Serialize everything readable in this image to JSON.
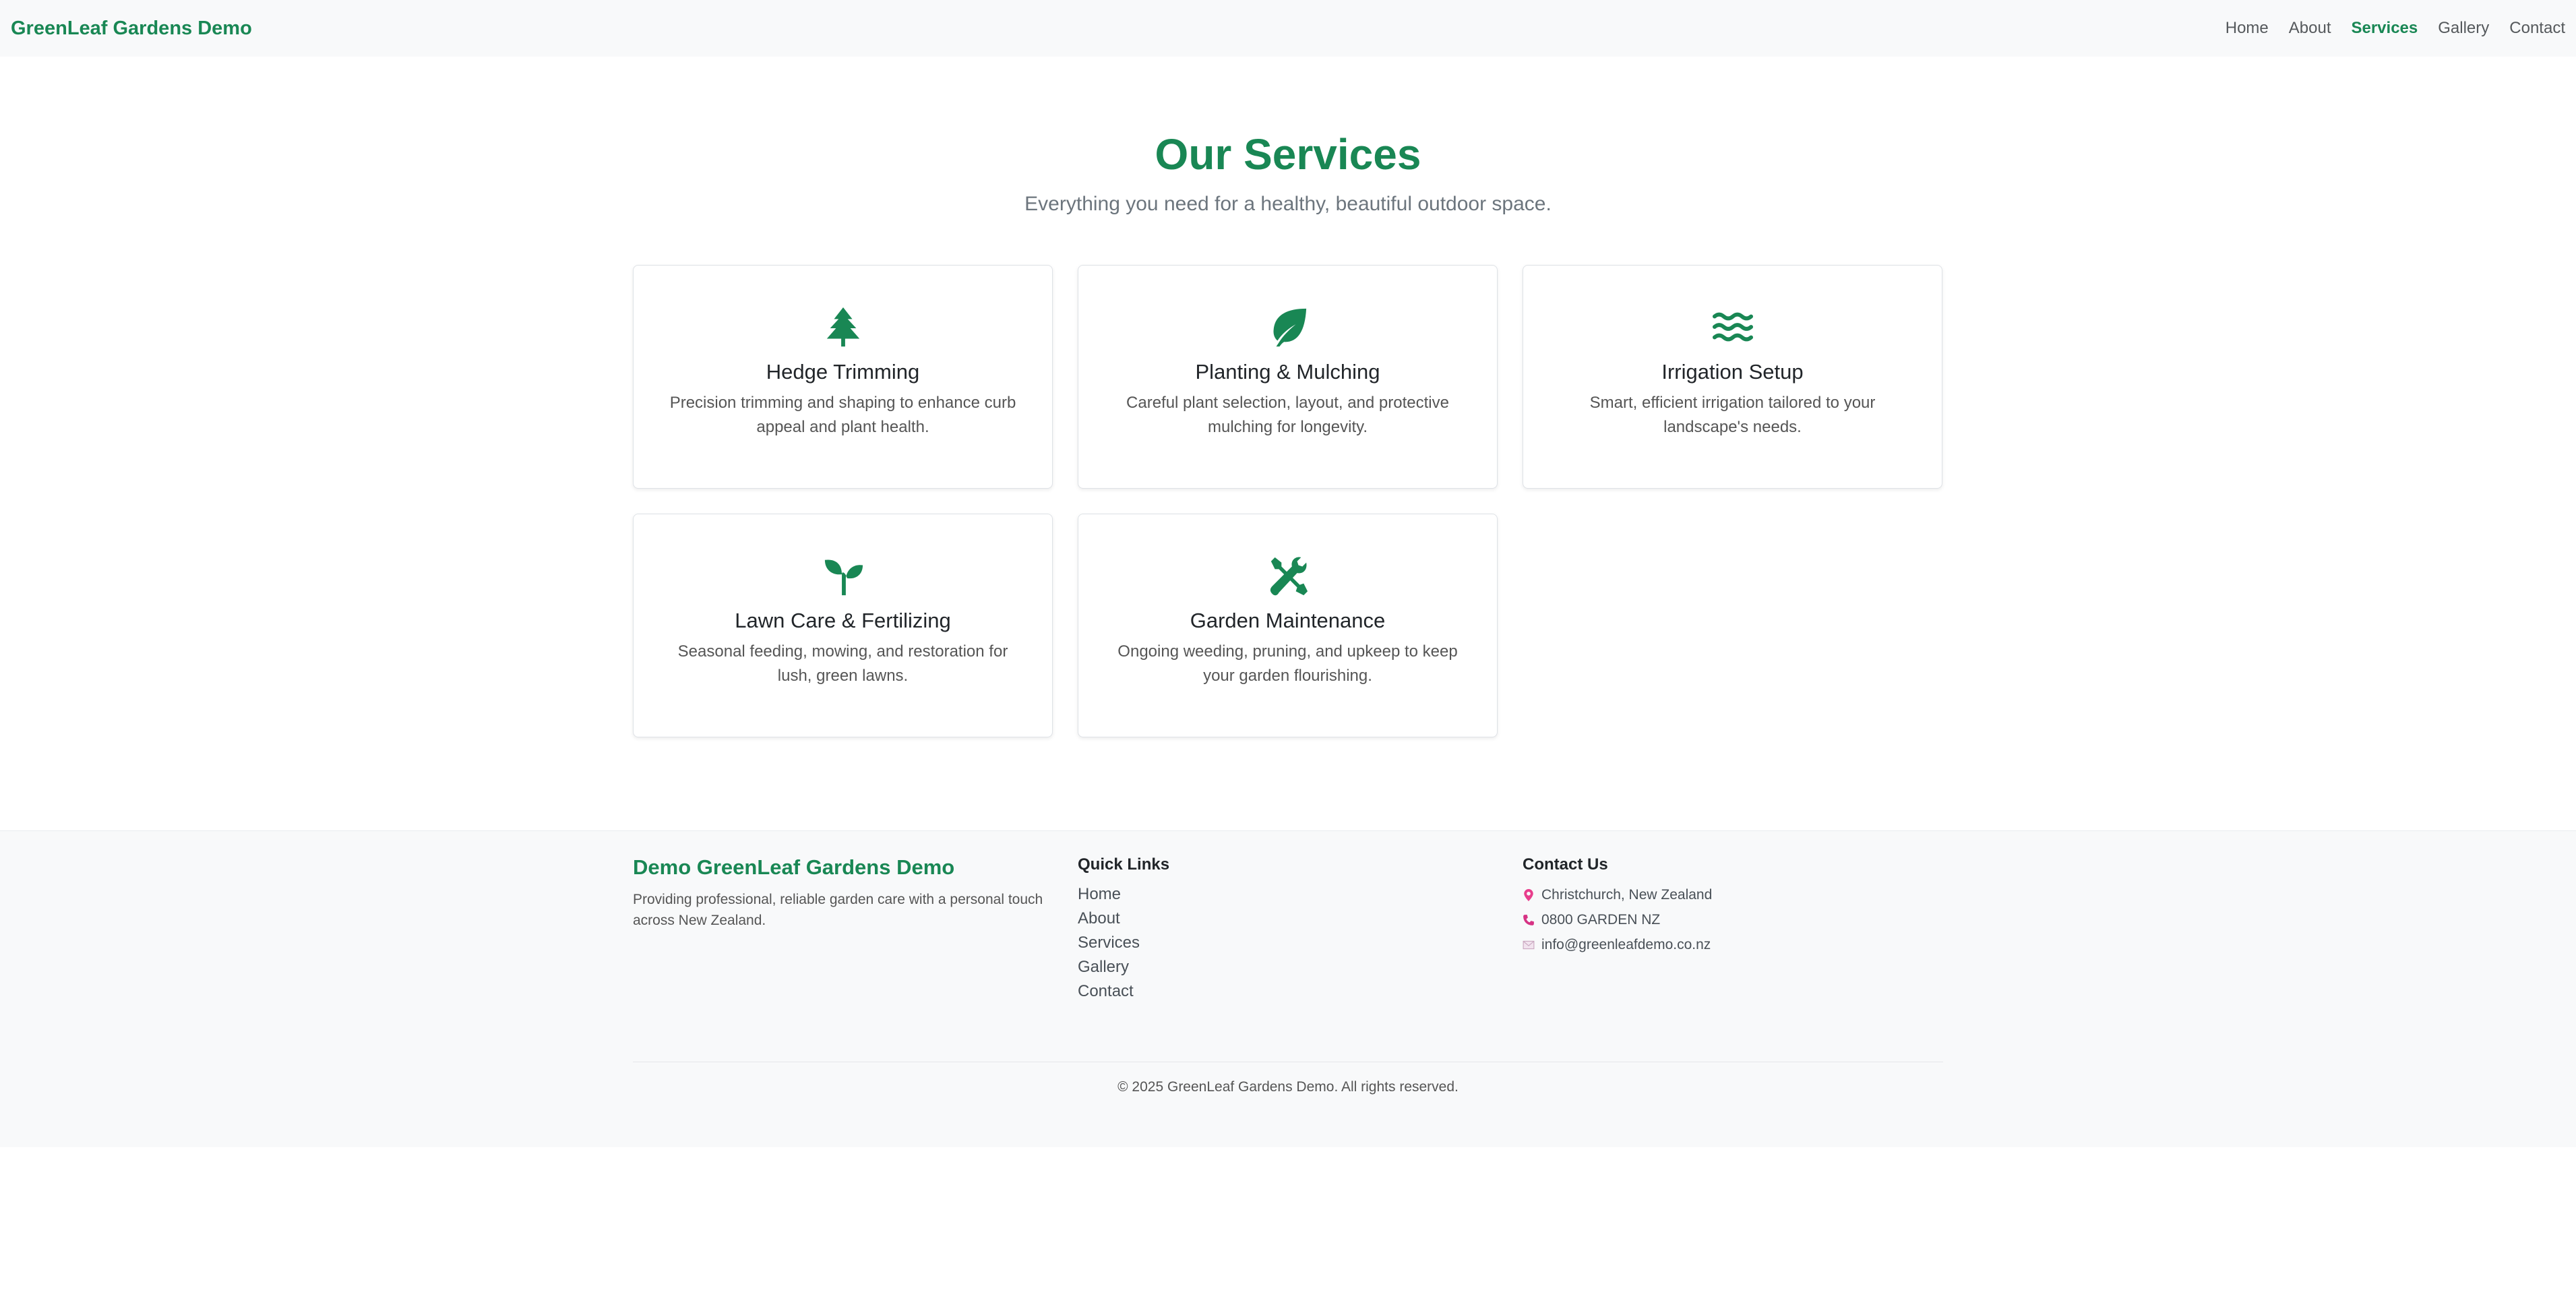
{
  "nav": {
    "brand": "GreenLeaf Gardens Demo",
    "links": [
      "Home",
      "About",
      "Services",
      "Gallery",
      "Contact"
    ],
    "active": "Services"
  },
  "hero": {
    "title": "Our Services",
    "subtitle": "Everything you need for a healthy, beautiful outdoor space."
  },
  "services": [
    {
      "icon": "tree-icon",
      "title": "Hedge Trimming",
      "desc": "Precision trimming and shaping to enhance curb appeal and plant health."
    },
    {
      "icon": "leaf-icon",
      "title": "Planting & Mulching",
      "desc": "Careful plant selection, layout, and protective mulching for longevity."
    },
    {
      "icon": "water-waves-icon",
      "title": "Irrigation Setup",
      "desc": "Smart, efficient irrigation tailored to your landscape's needs."
    },
    {
      "icon": "seedling-icon",
      "title": "Lawn Care & Fertilizing",
      "desc": "Seasonal feeding, mowing, and restoration for lush, green lawns."
    },
    {
      "icon": "tools-icon",
      "title": "Garden Maintenance",
      "desc": "Ongoing weeding, pruning, and upkeep to keep your garden flourishing."
    }
  ],
  "footer": {
    "brand": "Demo GreenLeaf Gardens Demo",
    "description": "Providing professional, reliable garden care with a personal touch across New Zealand.",
    "quick_links_title": "Quick Links",
    "quick_links": [
      "Home",
      "About",
      "Services",
      "Gallery",
      "Contact"
    ],
    "contact_title": "Contact Us",
    "contact": {
      "location": "Christchurch, New Zealand",
      "phone": "0800 GARDEN NZ",
      "email": "info@greenleafdemo.co.nz"
    },
    "copyright": "© 2025 GreenLeaf Gardens Demo. All rights reserved."
  },
  "colors": {
    "brand_green": "#198754",
    "contact_pin": "#e83e8c",
    "contact_phone": "#d63384"
  }
}
